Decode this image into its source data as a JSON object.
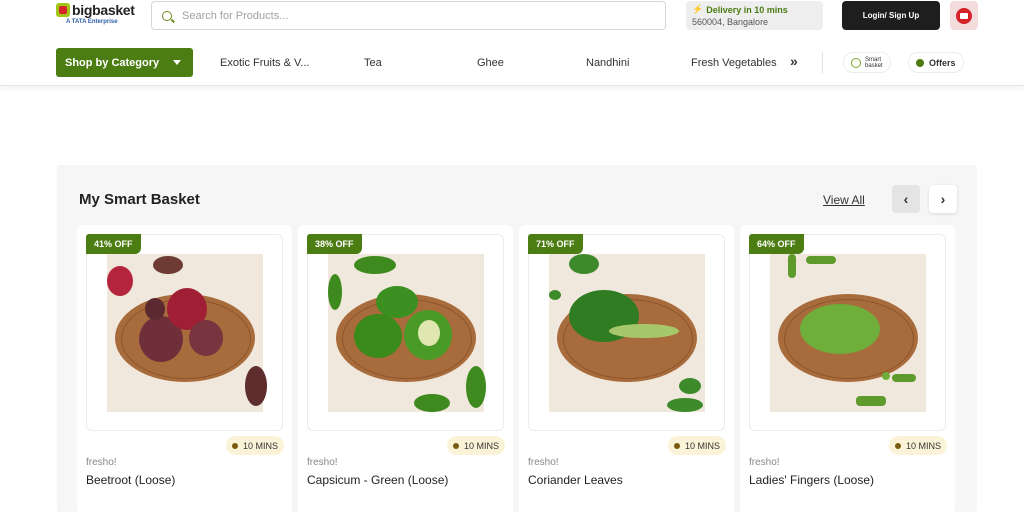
{
  "header": {
    "logo_text": "bigbasket",
    "logo_sub": "A TATA Enterprise",
    "search_placeholder": "Search for Products...",
    "delivery_title": "Delivery in 10 mins",
    "delivery_location": "560004, Bangalore",
    "login_label": "Login/ Sign Up"
  },
  "nav": {
    "shop_by_category": "Shop by Category",
    "links": [
      "Exotic Fruits & V...",
      "Tea",
      "Ghee",
      "Nandhini",
      "Fresh Vegetables"
    ],
    "more_symbol": "»",
    "smart_label_1": "Smart",
    "smart_label_2": "basket",
    "offers_label": "Offers"
  },
  "section": {
    "title": "My Smart Basket",
    "view_all": "View All",
    "prev_symbol": "‹",
    "next_symbol": "›"
  },
  "products": [
    {
      "discount": "41% OFF",
      "eta": "10 MINS",
      "brand": "fresho!",
      "name": "Beetroot (Loose)"
    },
    {
      "discount": "38% OFF",
      "eta": "10 MINS",
      "brand": "fresho!",
      "name": "Capsicum - Green (Loose)"
    },
    {
      "discount": "71% OFF",
      "eta": "10 MINS",
      "brand": "fresho!",
      "name": "Coriander Leaves"
    },
    {
      "discount": "64% OFF",
      "eta": "10 MINS",
      "brand": "fresho!",
      "name": "Ladies' Fingers (Loose)"
    }
  ],
  "colors": {
    "brand_green": "#4b7d13",
    "brand_red": "#d6232a",
    "eta_badge_bg": "#fbf3d8"
  }
}
